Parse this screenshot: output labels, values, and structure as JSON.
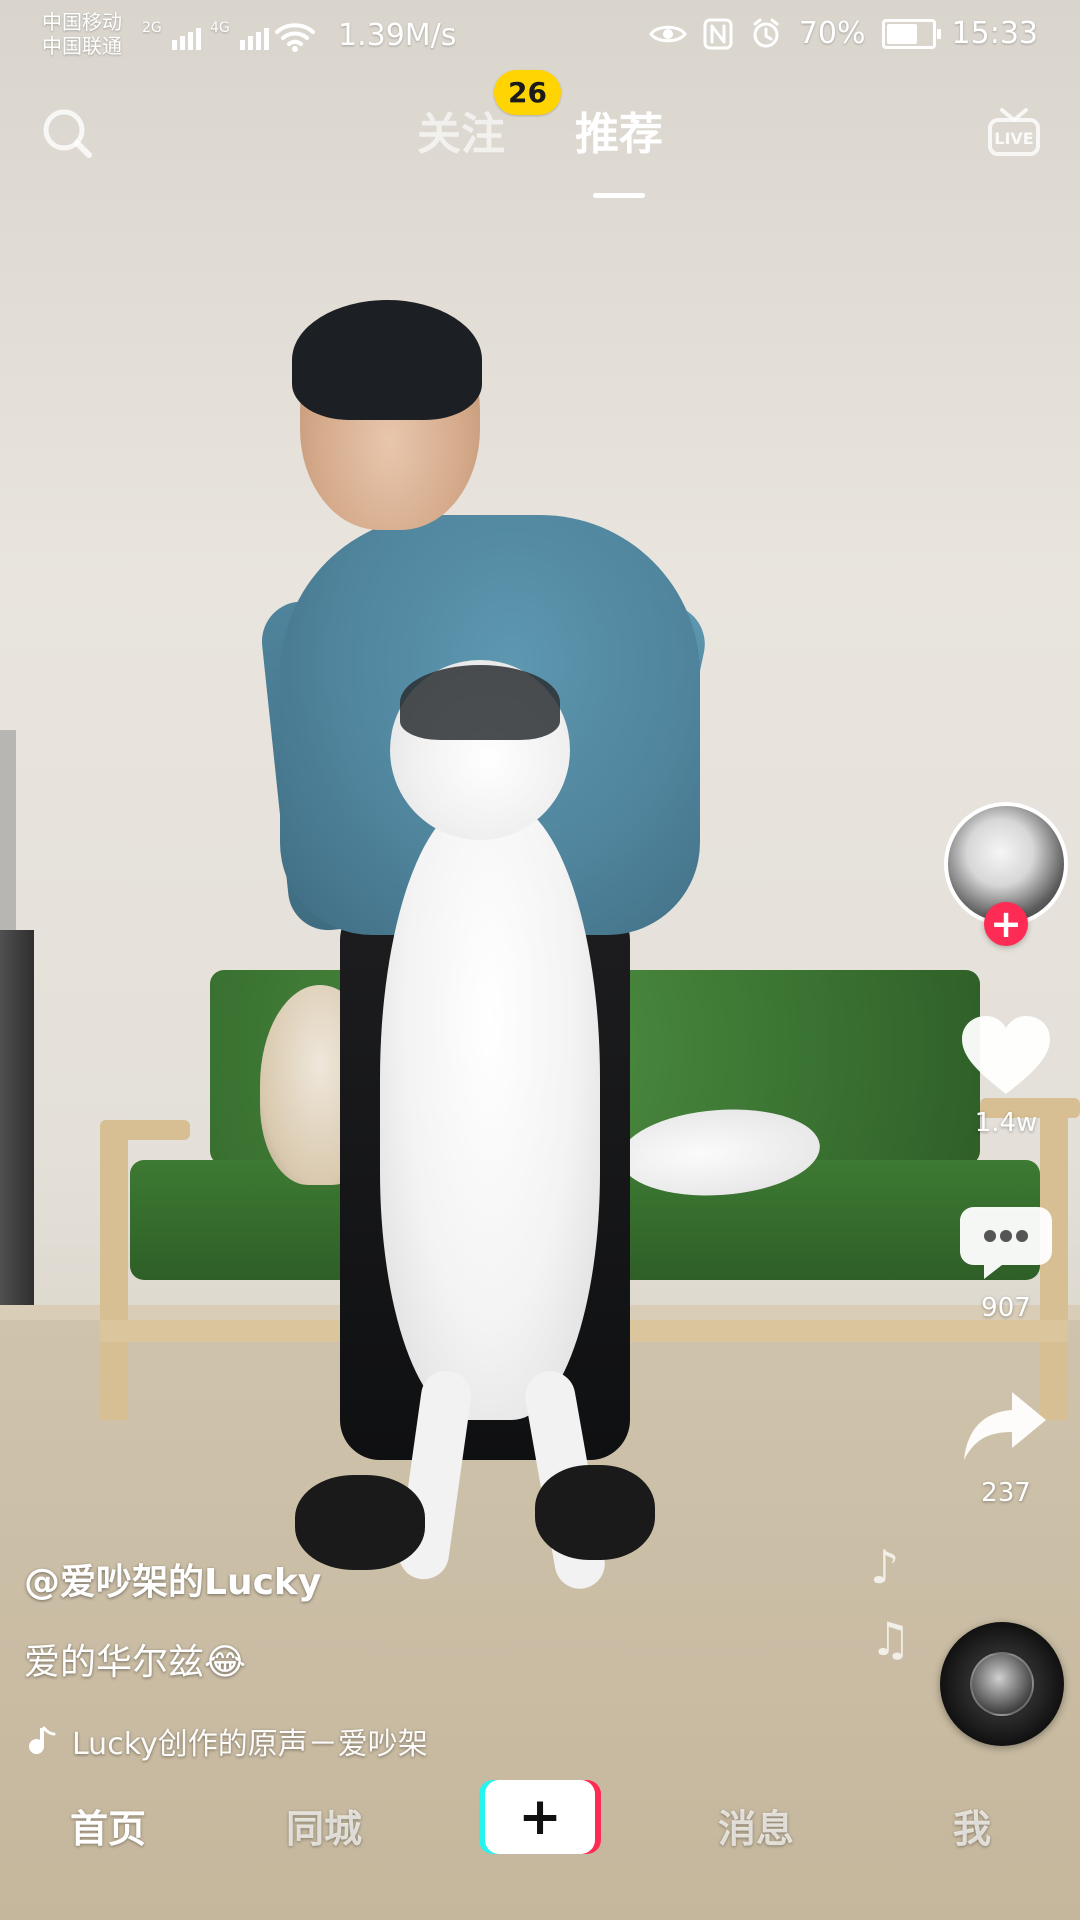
{
  "status_bar": {
    "carrier_top": "中国移动",
    "carrier_bottom": "中国联通",
    "net_tag_1": "2G",
    "net_tag_2": "4G",
    "speed": "1.39M/s",
    "battery_percent": "70%",
    "battery_level": 0.7,
    "time": "15:33",
    "icons": [
      "eye-icon",
      "nfc-icon",
      "alarm-icon",
      "wifi-icon",
      "battery-icon",
      "signal-icon"
    ]
  },
  "top_nav": {
    "tabs": [
      {
        "label": "关注",
        "badge": "26"
      },
      {
        "label": "推荐"
      }
    ],
    "live_label": "LIVE"
  },
  "right_rail": {
    "like_count": "1.4w",
    "comment_count": "907",
    "share_count": "237",
    "follow_plus": "+"
  },
  "caption": {
    "username": "@爱吵架的Lucky",
    "description": "爱的华尔兹😂",
    "music_text": "Lucky创作的原声－爱吵架"
  },
  "bottom_nav": {
    "items": [
      "首页",
      "同城",
      "消息",
      "我"
    ],
    "plus": "+"
  },
  "colors": {
    "accent_red": "#fe2c55",
    "accent_cyan": "#25f4ee",
    "badge_yellow": "#ffd400"
  }
}
